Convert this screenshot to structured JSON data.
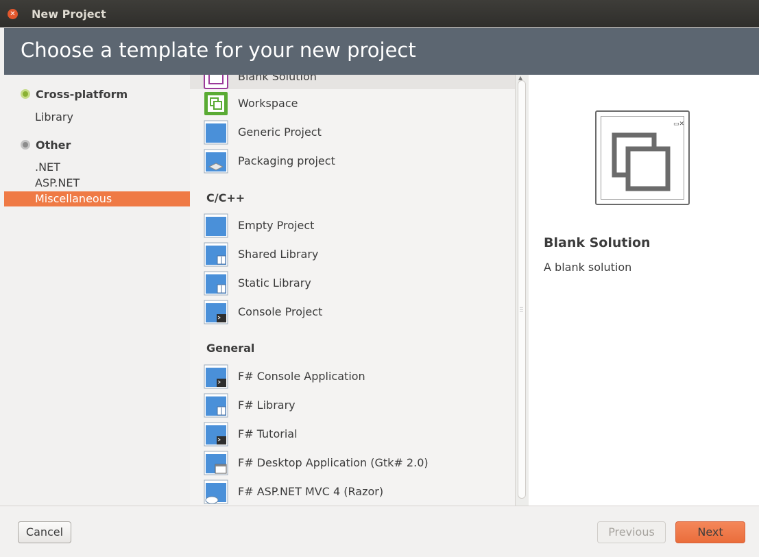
{
  "window": {
    "title": "New Project"
  },
  "banner": {
    "heading": "Choose a template for your new project"
  },
  "categories": {
    "groups": [
      {
        "label": "Cross-platform",
        "items": [
          "Library"
        ]
      },
      {
        "label": "Other",
        "items": [
          ".NET",
          "ASP.NET",
          "Miscellaneous"
        ]
      }
    ],
    "selected": "Miscellaneous"
  },
  "templates": {
    "top_items": [
      {
        "label": "Blank Solution",
        "icon": "blank-solution-icon"
      },
      {
        "label": "Workspace",
        "icon": "workspace-icon"
      },
      {
        "label": "Generic Project",
        "icon": "project-icon"
      },
      {
        "label": "Packaging project",
        "icon": "packaging-icon"
      }
    ],
    "sections": [
      {
        "label": "C/C++",
        "items": [
          {
            "label": "Empty Project",
            "icon": "project-icon"
          },
          {
            "label": "Shared Library",
            "icon": "library-icon"
          },
          {
            "label": "Static Library",
            "icon": "library-icon"
          },
          {
            "label": "Console Project",
            "icon": "console-icon"
          }
        ]
      },
      {
        "label": "General",
        "items": [
          {
            "label": "F# Console Application",
            "icon": "console-icon"
          },
          {
            "label": "F# Library",
            "icon": "library-icon"
          },
          {
            "label": "F# Tutorial",
            "icon": "console-icon"
          },
          {
            "label": "F# Desktop Application (Gtk# 2.0)",
            "icon": "desktop-app-icon"
          },
          {
            "label": "F# ASP.NET MVC 4 (Razor)",
            "icon": "web-icon"
          }
        ]
      }
    ]
  },
  "preview": {
    "title": "Blank Solution",
    "description": "A blank solution"
  },
  "footer": {
    "cancel_label": "Cancel",
    "previous_label": "Previous",
    "next_label": "Next"
  },
  "colors": {
    "accent": "#ef7a45",
    "banner": "#5c6671",
    "titlebar": "#3b3a36",
    "icon_blue": "#4a90d9"
  }
}
